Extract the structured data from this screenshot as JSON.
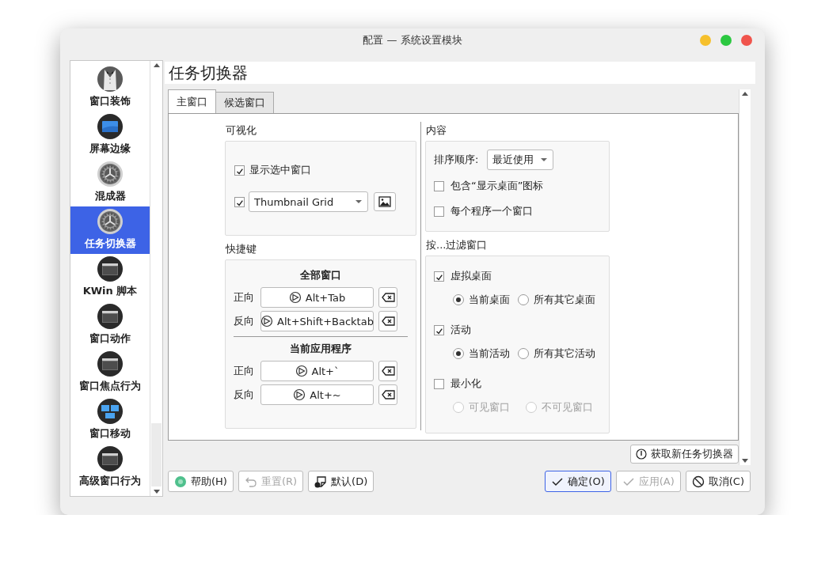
{
  "window": {
    "title": "配置 — 系统设置模块"
  },
  "sidebar": {
    "items": [
      {
        "label": "窗口装饰",
        "kind": "tuxedo",
        "selected": false
      },
      {
        "label": "屏幕边缘",
        "kind": "screen",
        "selected": false
      },
      {
        "label": "混成器",
        "kind": "gear",
        "selected": false
      },
      {
        "label": "任务切换器",
        "kind": "gear",
        "selected": true
      },
      {
        "label": "KWin 脚本",
        "kind": "window",
        "selected": false
      },
      {
        "label": "窗口动作",
        "kind": "window",
        "selected": false
      },
      {
        "label": "窗口焦点行为",
        "kind": "window",
        "selected": false
      },
      {
        "label": "窗口移动",
        "kind": "tiles",
        "selected": false
      },
      {
        "label": "高级窗口行为",
        "kind": "window",
        "selected": false
      }
    ]
  },
  "header": "任务切换器",
  "tabs": [
    {
      "label": "主窗口",
      "selected": true
    },
    {
      "label": "候选窗口",
      "selected": false
    }
  ],
  "visualization": {
    "title": "可视化",
    "show_selected": {
      "label": "显示选中窗口",
      "checked": true
    },
    "layout": {
      "checked": true,
      "value": "Thumbnail Grid"
    }
  },
  "shortcuts": {
    "title": "快捷键",
    "groups": [
      {
        "title": "全部窗口",
        "rows": [
          {
            "label": "正向",
            "key": "Alt+Tab"
          },
          {
            "label": "反向",
            "key": "Alt+Shift+Backtab"
          }
        ]
      },
      {
        "title": "当前应用程序",
        "rows": [
          {
            "label": "正向",
            "key": "Alt+`"
          },
          {
            "label": "反向",
            "key": "Alt+~"
          }
        ]
      }
    ]
  },
  "content": {
    "title": "内容",
    "sort_label": "排序顺序:",
    "sort_value": "最近使用",
    "options": [
      {
        "label": "包含“显示桌面”图标",
        "checked": false
      },
      {
        "label": "每个程序一个窗口",
        "checked": false
      }
    ]
  },
  "filter": {
    "title": "按...过滤窗口",
    "groups": [
      {
        "label": "虚拟桌面",
        "checked": true,
        "choices": [
          {
            "label": "当前桌面",
            "selected": true
          },
          {
            "label": "所有其它桌面",
            "selected": false
          }
        ]
      },
      {
        "label": "活动",
        "checked": true,
        "choices": [
          {
            "label": "当前活动",
            "selected": true
          },
          {
            "label": "所有其它活动",
            "selected": false
          }
        ]
      },
      {
        "label": "最小化",
        "checked": false,
        "choices": [
          {
            "label": "可见窗口",
            "selected": false
          },
          {
            "label": "不可见窗口",
            "selected": false
          }
        ]
      }
    ]
  },
  "get_new": "获取新任务切换器",
  "buttons": [
    {
      "label": "帮助(H)",
      "kind": "help",
      "disabled": false
    },
    {
      "label": "重置(R)",
      "kind": "reset",
      "disabled": true
    },
    {
      "label": "默认(D)",
      "kind": "default",
      "disabled": false
    },
    {
      "label": "确定(O)",
      "kind": "ok",
      "disabled": false
    },
    {
      "label": "应用(A)",
      "kind": "apply",
      "disabled": true
    },
    {
      "label": "取消(C)",
      "kind": "cancel",
      "disabled": false
    }
  ]
}
